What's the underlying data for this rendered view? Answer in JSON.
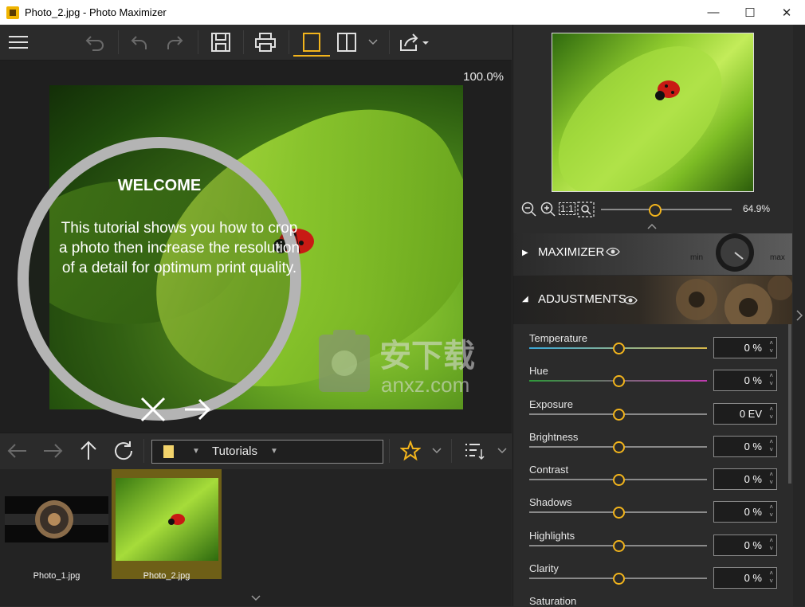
{
  "window": {
    "title": "Photo_2.jpg - Photo Maximizer",
    "minimize": "—",
    "maximize": "☐",
    "close": "✕"
  },
  "viewer": {
    "zoom": "100.0%",
    "tutorial": {
      "heading": "WELCOME",
      "body": "This tutorial shows you how to crop a photo then increase the resolution of a detail for optimum print quality."
    }
  },
  "navbar": {
    "folder": "Tutorials"
  },
  "thumbnails": [
    {
      "name": "Photo_1.jpg",
      "selected": false
    },
    {
      "name": "Photo_2.jpg",
      "selected": true
    }
  ],
  "navigator": {
    "zoom": "64.9%",
    "fit_label": "1:1"
  },
  "sections": {
    "maximizer": {
      "title": "MAXIMIZER",
      "min": "min",
      "max": "max"
    },
    "adjustments": {
      "title": "ADJUSTMENTS"
    }
  },
  "adjustments": [
    {
      "label": "Temperature",
      "value": "0 %"
    },
    {
      "label": "Hue",
      "value": "0 %"
    },
    {
      "label": "Exposure",
      "value": "0 EV"
    },
    {
      "label": "Brightness",
      "value": "0 %"
    },
    {
      "label": "Contrast",
      "value": "0 %"
    },
    {
      "label": "Shadows",
      "value": "0 %"
    },
    {
      "label": "Highlights",
      "value": "0 %"
    },
    {
      "label": "Clarity",
      "value": "0 %"
    },
    {
      "label": "Saturation",
      "value": ""
    }
  ],
  "watermark": {
    "text": "安下载",
    "sub": "anxz.com"
  },
  "colors": {
    "accent": "#f2b41c",
    "selected_thumb": "#6e5f17",
    "panel_bg": "#2b2b2b"
  }
}
